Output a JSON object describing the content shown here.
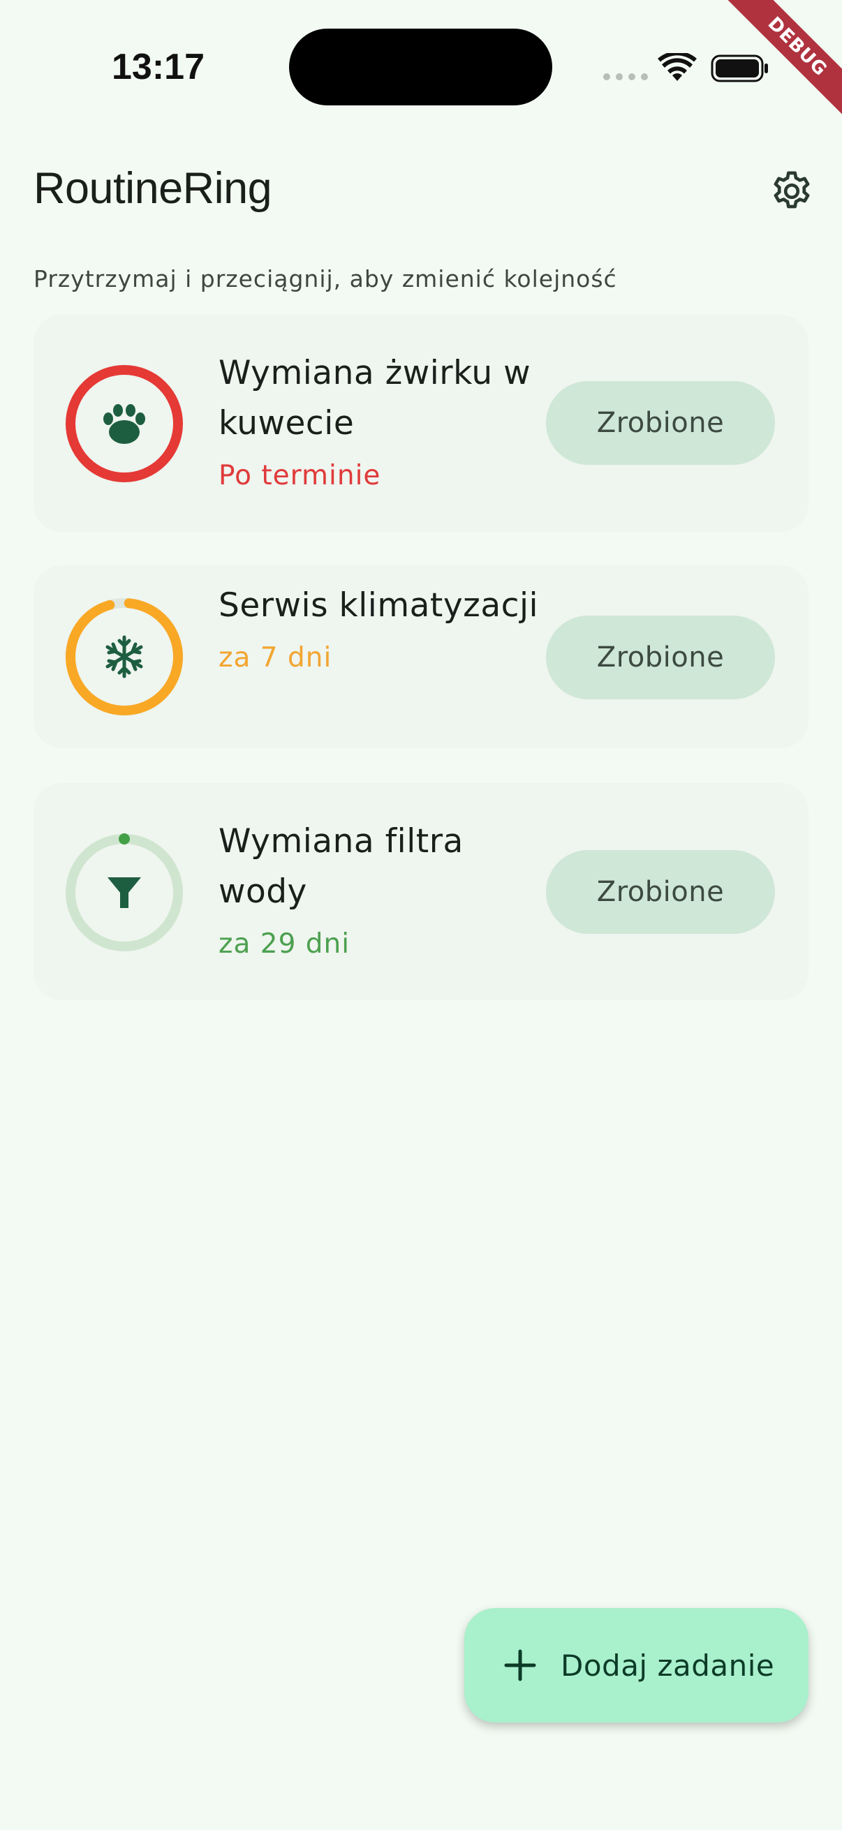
{
  "status_bar": {
    "time": "13:17",
    "debug_label": "DEBUG"
  },
  "header": {
    "title": "RoutineRing",
    "settings_icon": "gear-icon"
  },
  "hint": "Przytrzymaj i przeciągnij, aby zmienić kolejność",
  "tasks": [
    {
      "title": "Wymiana żwirku w kuwecie",
      "status": "Po terminie",
      "status_color": "#e03a3a",
      "icon": "paw-icon",
      "ring_color": "#e53935",
      "progress": 1.0,
      "done_label": "Zrobione"
    },
    {
      "title": "Serwis klimatyzacji",
      "status": "za 7 dni",
      "status_color": "#f2a531",
      "icon": "snowflake-icon",
      "ring_color": "#f9a825",
      "progress": 0.95,
      "done_label": "Zrobione"
    },
    {
      "title": "Wymiana filtra wody",
      "status": "za 29 dni",
      "status_color": "#4ca04f",
      "icon": "funnel-icon",
      "ring_color": "#43a047",
      "progress": 0.0,
      "done_label": "Zrobione"
    }
  ],
  "fab": {
    "label": "Dodaj zadanie",
    "icon": "plus-icon"
  },
  "colors": {
    "background": "#f3faf3",
    "card": "#eff5ef",
    "button": "#cfe7d6",
    "fab": "#a9f0cc",
    "icon_green": "#1e5e40"
  }
}
